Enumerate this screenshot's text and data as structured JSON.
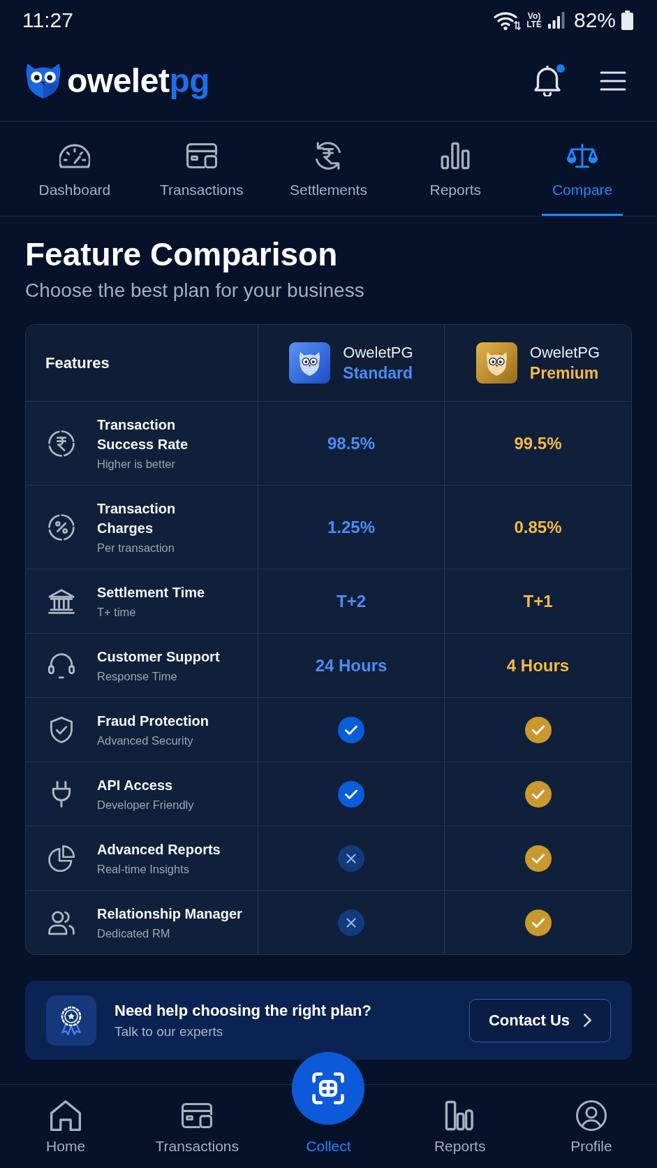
{
  "status_bar": {
    "time": "11:27",
    "volte": "Vo)",
    "network": "LTE",
    "battery": "82%"
  },
  "header": {
    "brand": "owelet",
    "brand_accent": "pg",
    "has_notification": true
  },
  "tabs": [
    {
      "label": "Dashboard",
      "selected": false
    },
    {
      "label": "Transactions",
      "selected": false
    },
    {
      "label": "Settlements",
      "selected": false
    },
    {
      "label": "Reports",
      "selected": false
    },
    {
      "label": "Compare",
      "selected": true
    }
  ],
  "page": {
    "title": "Feature Comparison",
    "subtitle": "Choose the best plan for your business"
  },
  "comparison": {
    "features_heading": "Features",
    "plans": [
      {
        "name": "OweletPG",
        "tier": "Standard",
        "kind": "standard",
        "color": "#4a8cf5"
      },
      {
        "name": "OweletPG",
        "tier": "Premium",
        "kind": "premium",
        "color": "#f5b942"
      }
    ],
    "rows": [
      {
        "kind": "value",
        "title": "Transaction\nSuccess Rate",
        "note": "Higher is better",
        "values": [
          "98.5%",
          "99.5%"
        ]
      },
      {
        "kind": "value",
        "title": "Transaction\nCharges",
        "note": "Per transaction",
        "values": [
          "1.25%",
          "0.85%"
        ]
      },
      {
        "kind": "value",
        "title": "Settlement Time",
        "note": "T+ time",
        "values": [
          "T+2",
          "T+1"
        ]
      },
      {
        "kind": "value",
        "title": "Customer Support",
        "note": "Response Time",
        "values": [
          "24 Hours",
          "4 Hours"
        ]
      },
      {
        "kind": "check",
        "title": "Fraud Protection",
        "note": "Advanced Security",
        "included": [
          true,
          true
        ]
      },
      {
        "kind": "check",
        "title": "API Access",
        "note": "Developer Friendly",
        "included": [
          true,
          true
        ]
      },
      {
        "kind": "check",
        "title": "Advanced Reports",
        "note": "Real-time Insights",
        "included": [
          false,
          true
        ]
      },
      {
        "kind": "check",
        "title": "Relationship Manager",
        "note": "Dedicated RM",
        "included": [
          false,
          true
        ]
      }
    ]
  },
  "help_banner": {
    "title": "Need help choosing the right plan?",
    "subtitle": "Talk to our experts",
    "button": "Contact Us"
  },
  "bottom_nav": [
    {
      "label": "Home",
      "kind": "tab",
      "selected": false
    },
    {
      "label": "Transactions",
      "kind": "tab",
      "selected": false
    },
    {
      "label": "Collect",
      "kind": "fab",
      "selected": true
    },
    {
      "label": "Reports",
      "kind": "tab",
      "selected": false
    },
    {
      "label": "Profile",
      "kind": "tab",
      "selected": false
    }
  ]
}
